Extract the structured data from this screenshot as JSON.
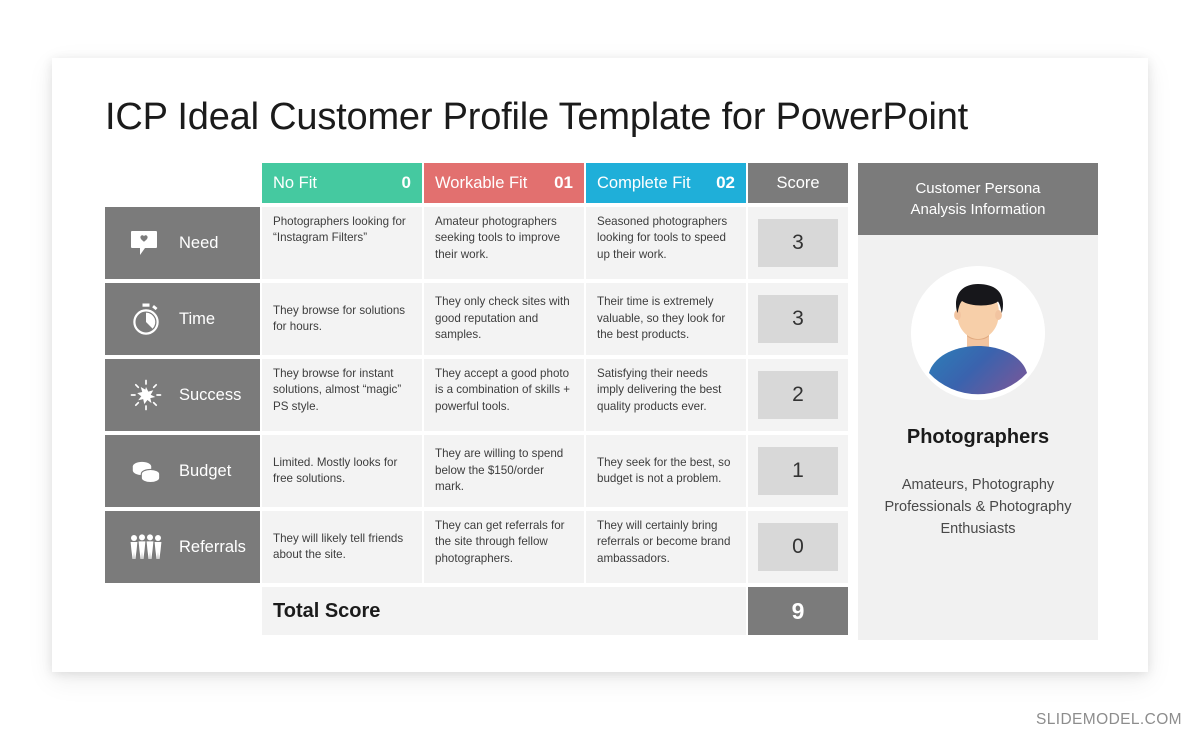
{
  "title": "ICP Ideal Customer Profile Template for PowerPoint",
  "watermark": "SLIDEMODEL.COM",
  "colors": {
    "no_fit": "#45C9A0",
    "workable_fit": "#E2706F",
    "complete_fit": "#1FAFD9",
    "grey": "#7B7B7B",
    "cell_bg": "#F3F3F3",
    "score_box": "#D8D8D8"
  },
  "headers": {
    "spacer": "",
    "no_fit": {
      "label": "No Fit",
      "num": "0"
    },
    "workable_fit": {
      "label": "Workable  Fit",
      "num": "01"
    },
    "complete_fit": {
      "label": "Complete Fit",
      "num": "02"
    },
    "score": "Score"
  },
  "rows": [
    {
      "icon": "speech-bubble-heart-icon",
      "label": "Need",
      "no_fit": "Photographers looking for “Instagram Filters”",
      "workable_fit": "Amateur photographers seeking tools to improve their work.",
      "complete_fit": "Seasoned photographers looking for tools to speed  up their work.",
      "score": "3"
    },
    {
      "icon": "stopwatch-icon",
      "label": "Time",
      "no_fit": "They browse for solutions for hours.",
      "workable_fit": "They only check sites with good  reputation and samples.",
      "complete_fit": "Their time is extremely valuable, so they look for the  best products.",
      "score": "3"
    },
    {
      "icon": "starburst-icon",
      "label": "Success",
      "no_fit": "They browse for instant solutions, almost “magic” PS style.",
      "workable_fit": "They accept  a good photo  is a combination  of skills + powerful tools.",
      "complete_fit": "Satisfying their needs imply delivering the best quality products ever.",
      "score": "2"
    },
    {
      "icon": "coins-icon",
      "label": "Budget",
      "no_fit": "Limited. Mostly looks for free solutions.",
      "workable_fit": "They are willing to spend below the $150/order mark.",
      "complete_fit": "They seek for the best, so budget  is not a problem.",
      "score": "1"
    },
    {
      "icon": "people-group-icon",
      "label": "Referrals",
      "no_fit": "They will likely tell friends about  the site.",
      "workable_fit": "They can get  referrals for the site through fellow photographers.",
      "complete_fit": "They will certainly bring referrals or become  brand ambassadors.",
      "score": "0"
    }
  ],
  "total": {
    "label": "Total Score",
    "value": "9"
  },
  "persona": {
    "header_line1": "Customer Persona",
    "header_line2": "Analysis Information",
    "avatar_alt": "male-photographer-avatar",
    "name": "Photographers",
    "description": "Amateurs, Photography Professionals & Photography Enthusiasts"
  }
}
